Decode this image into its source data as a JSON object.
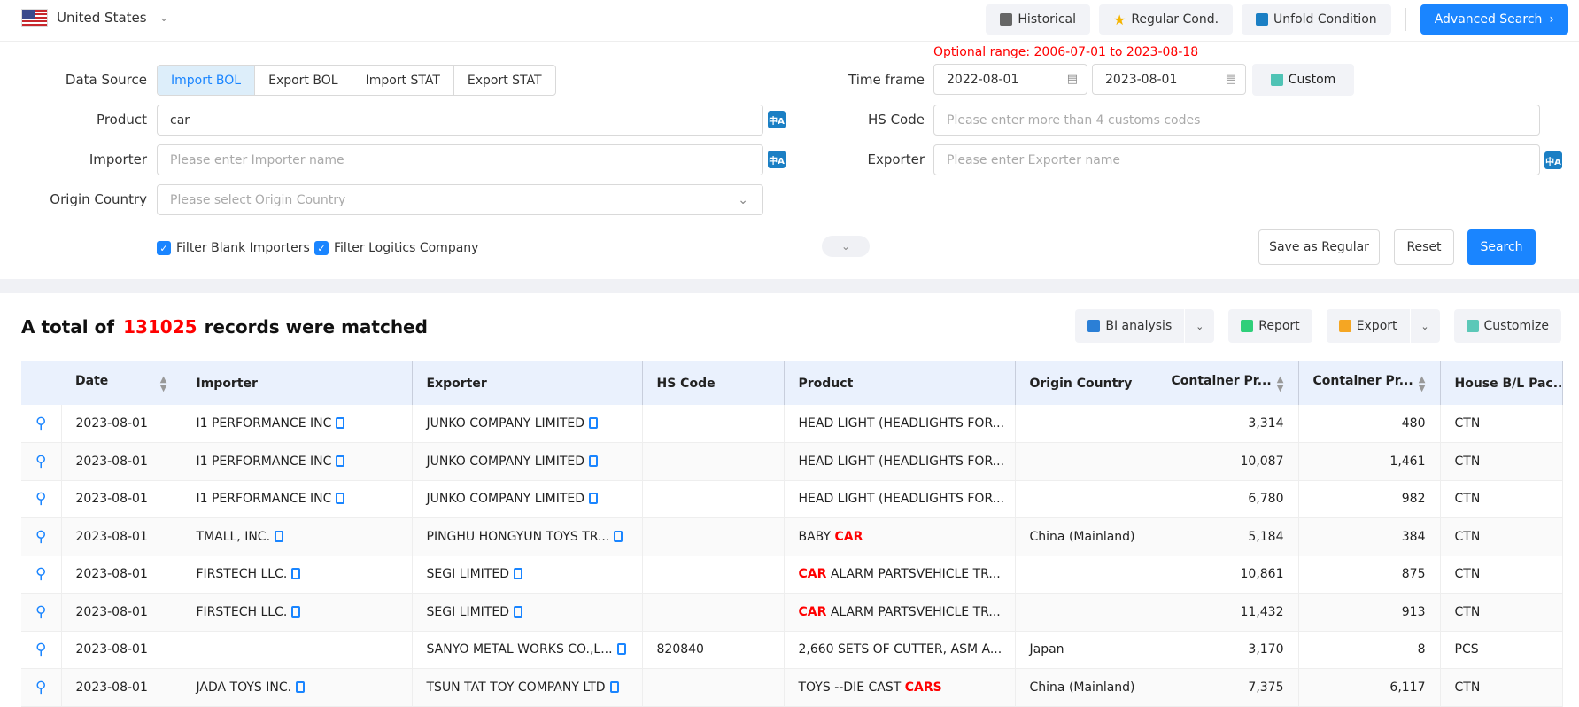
{
  "topbar": {
    "country": "United States",
    "buttons": {
      "historical": "Historical",
      "regular": "Regular Cond.",
      "unfold": "Unfold Condition",
      "advanced": "Advanced Search"
    }
  },
  "form": {
    "data_source_label": "Data Source",
    "data_sources": [
      "Import BOL",
      "Export BOL",
      "Import STAT",
      "Export STAT"
    ],
    "active_source": "Import BOL",
    "product_label": "Product",
    "product_value": "car",
    "importer_label": "Importer",
    "importer_placeholder": "Please enter Importer name",
    "origin_label": "Origin Country",
    "origin_placeholder": "Please select Origin Country",
    "optional_range": "Optional range:  2006-07-01 to 2023-08-18",
    "timeframe_label": "Time frame",
    "date_from": "2022-08-01",
    "date_to": "2023-08-01",
    "custom_label": "Custom",
    "hs_label": "HS Code",
    "hs_placeholder": "Please enter more than 4 customs codes",
    "exporter_label": "Exporter",
    "exporter_placeholder": "Please enter Exporter name",
    "filter_blank": "Filter Blank Importers",
    "filter_logistics": "Filter Logitics Company",
    "save_regular": "Save as Regular",
    "reset": "Reset",
    "search": "Search"
  },
  "results": {
    "prefix": "A total of",
    "count": "131025",
    "suffix": "records were matched",
    "tools": {
      "bi": "BI analysis",
      "report": "Report",
      "export": "Export",
      "customize": "Customize"
    }
  },
  "table": {
    "headers": [
      "Date",
      "Importer",
      "Exporter",
      "HS Code",
      "Product",
      "Origin Country",
      "Container Pr...",
      "Container Pr...",
      "House B/L Pac..."
    ],
    "rows": [
      {
        "date": "2023-08-01",
        "importer": "I1 PERFORMANCE INC",
        "exporter": "JUNKO COMPANY LIMITED",
        "hs": "",
        "product_pre": "HEAD LIGHT (HEADLIGHTS FOR...",
        "product_hl": "",
        "product_post": "",
        "origin": "",
        "c1": "3,314",
        "c2": "480",
        "pkg": "CTN"
      },
      {
        "date": "2023-08-01",
        "importer": "I1 PERFORMANCE INC",
        "exporter": "JUNKO COMPANY LIMITED",
        "hs": "",
        "product_pre": "HEAD LIGHT (HEADLIGHTS FOR...",
        "product_hl": "",
        "product_post": "",
        "origin": "",
        "c1": "10,087",
        "c2": "1,461",
        "pkg": "CTN"
      },
      {
        "date": "2023-08-01",
        "importer": "I1 PERFORMANCE INC",
        "exporter": "JUNKO COMPANY LIMITED",
        "hs": "",
        "product_pre": "HEAD LIGHT (HEADLIGHTS FOR...",
        "product_hl": "",
        "product_post": "",
        "origin": "",
        "c1": "6,780",
        "c2": "982",
        "pkg": "CTN"
      },
      {
        "date": "2023-08-01",
        "importer": "TMALL, INC.",
        "exporter": "PINGHU HONGYUN TOYS TR...",
        "hs": "",
        "product_pre": "BABY ",
        "product_hl": "CAR",
        "product_post": "",
        "origin": "China (Mainland)",
        "c1": "5,184",
        "c2": "384",
        "pkg": "CTN"
      },
      {
        "date": "2023-08-01",
        "importer": "FIRSTECH LLC.",
        "exporter": "SEGI LIMITED",
        "hs": "",
        "product_pre": "",
        "product_hl": "CAR",
        "product_post": " ALARM PARTSVEHICLE TR...",
        "origin": "",
        "c1": "10,861",
        "c2": "875",
        "pkg": "CTN"
      },
      {
        "date": "2023-08-01",
        "importer": "FIRSTECH LLC.",
        "exporter": "SEGI LIMITED",
        "hs": "",
        "product_pre": "",
        "product_hl": "CAR",
        "product_post": " ALARM PARTSVEHICLE TR...",
        "origin": "",
        "c1": "11,432",
        "c2": "913",
        "pkg": "CTN"
      },
      {
        "date": "2023-08-01",
        "importer": "",
        "exporter": "SANYO METAL WORKS CO.,L...",
        "hs": "820840",
        "product_pre": "2,660 SETS OF CUTTER, ASM A...",
        "product_hl": "",
        "product_post": "",
        "origin": "Japan",
        "c1": "3,170",
        "c2": "8",
        "pkg": "PCS"
      },
      {
        "date": "2023-08-01",
        "importer": "JADA TOYS INC.",
        "exporter": "TSUN TAT TOY COMPANY LTD",
        "hs": "",
        "product_pre": "TOYS --DIE CAST ",
        "product_hl": "CARS",
        "product_post": "",
        "origin": "China (Mainland)",
        "c1": "7,375",
        "c2": "6,117",
        "pkg": "CTN"
      }
    ]
  }
}
